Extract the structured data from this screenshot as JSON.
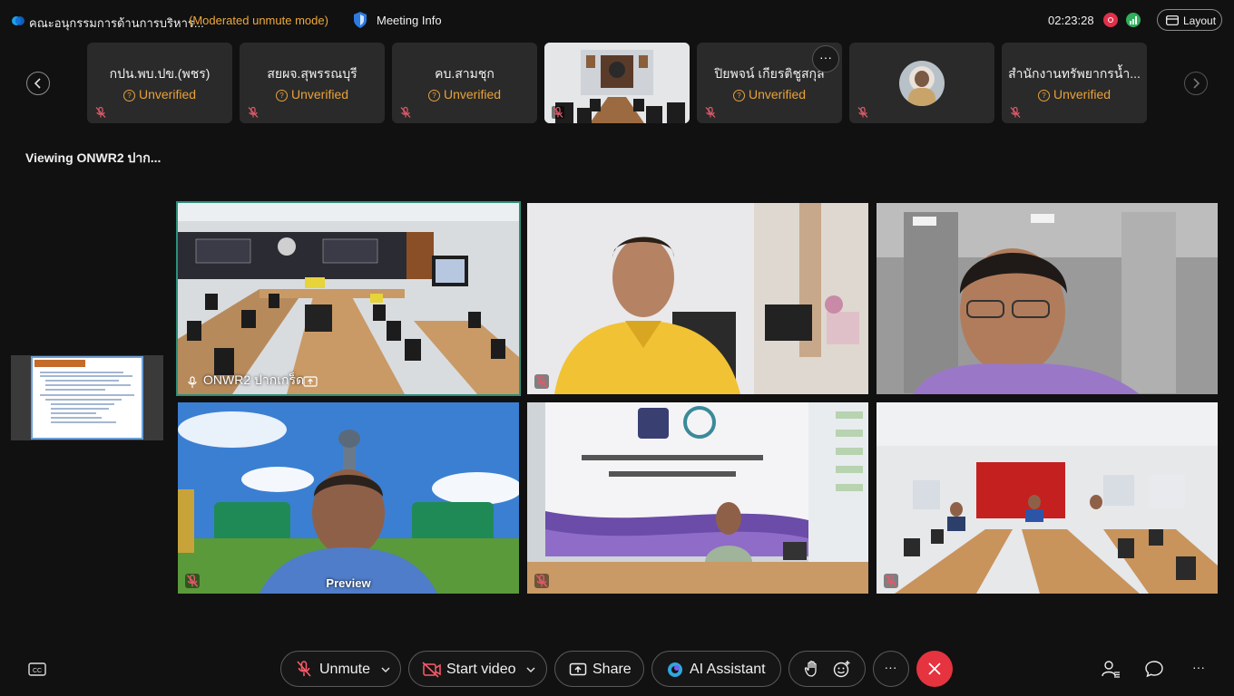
{
  "header": {
    "meeting_title": "คณะอนุกรรมการด้านการบริหาร...",
    "mode": "(Moderated unmute mode)",
    "meeting_info": "Meeting Info",
    "clock": "02:23:28",
    "layout_label": "Layout"
  },
  "strip": {
    "participants": [
      {
        "name": "กปน.พบ.ปข.(พชร)",
        "status": "Unverified"
      },
      {
        "name": "สยผจ.สุพรรณบุรี",
        "status": "Unverified"
      },
      {
        "name": "คบ.สามชุก",
        "status": "Unverified"
      },
      {
        "name": "",
        "status": ""
      },
      {
        "name": "ปิยพจน์  เกียรติชูสกุล",
        "status": "Unverified"
      },
      {
        "name": "",
        "status": ""
      },
      {
        "name": "สำนักงานทรัพยากรน้ำ...",
        "status": "Unverified"
      }
    ]
  },
  "viewing_text": "Viewing ONWR2 ปาก...",
  "grid": {
    "active_name": "ONWR2 ปากเกร็ด",
    "preview_label": "Preview"
  },
  "toolbar": {
    "unmute": "Unmute",
    "start_video": "Start video",
    "share": "Share",
    "ai_assistant": "AI Assistant",
    "more": "···"
  },
  "colors": {
    "accent_orange": "#f0a83a",
    "end_red": "#e5343f",
    "active_border": "#2f8f7a",
    "record_red": "#e0304a",
    "signal_green": "#2fb05a"
  }
}
